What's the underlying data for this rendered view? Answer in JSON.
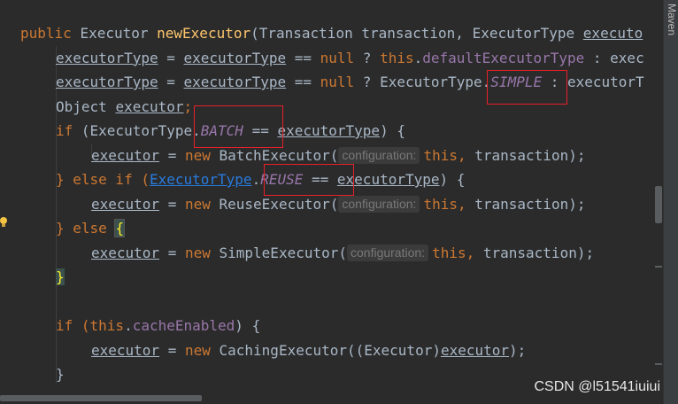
{
  "editor": {
    "lines": [
      {
        "id": "l1"
      },
      {
        "id": "l2"
      }
    ],
    "tokens": {
      "public": "public",
      "executor_type_ret": "Executor",
      "method_name": "newExecutor",
      "params_open": "(Transaction transaction, ExecutorType ",
      "param_exec": "executo",
      "exec_type_var": "executorType",
      "assign_eq": " = ",
      "eqeq": " == ",
      "null": "null",
      "q": " ? ",
      "this": "this",
      "default_field": "defaultExecutorType",
      "colon_exec": " : exec",
      "executor_type_class": "ExecutorType.",
      "simple": "SIMPLE",
      "colon_exec2": " : executorT",
      "object_decl": "Object ",
      "executor_var": "executor",
      "semi": ";",
      "if": "if",
      "open_paren": " (",
      "batch": "BATCH",
      "close_brace_open": ") {",
      "new": "new",
      "batch_executor": " BatchExecutor(",
      "hint": "configuration:",
      "this_tx": " transaction);",
      "this_tx_comma": ", transaction);",
      "else_if": "} else if (",
      "executor_type_link": "ExecutorType",
      "dot": ".",
      "reuse": "REUSE",
      "reuse_executor": " ReuseExecutor(",
      "else": "} else ",
      "open_brace": "{",
      "simple_executor": " SimpleExecutor(",
      "close_brace": "}",
      "cache_if": "if (",
      "cache_field": "cacheEnabled",
      "cache_close": ") {",
      "caching": " CachingExecutor((Executor)",
      "end_call": ");",
      "final_brace": "}"
    }
  },
  "side_panel": {
    "label": "Maven"
  },
  "watermark": "CSDN @l51541iuiui"
}
